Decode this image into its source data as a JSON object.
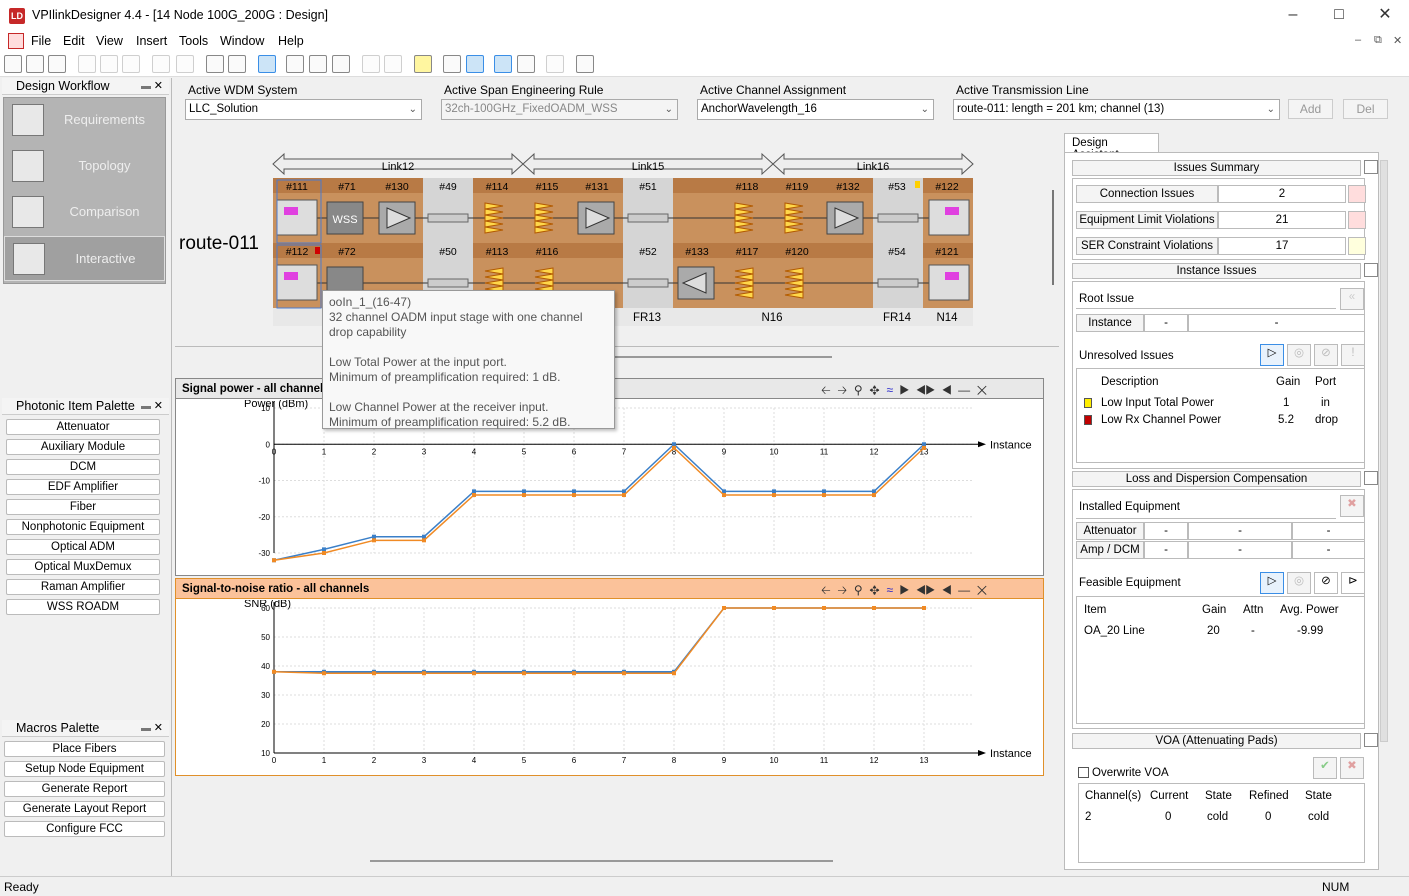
{
  "window": {
    "title": "VPIlinkDesigner 4.4 - [14 Node 100G_200G : Design]",
    "logo": "LD"
  },
  "menu": [
    "File",
    "Edit",
    "View",
    "Insert",
    "Tools",
    "Window",
    "Help"
  ],
  "left": {
    "workflow_title": "Design Workflow",
    "workflow": [
      "Requirements",
      "Topology",
      "Comparison",
      "Interactive"
    ],
    "palette_title": "Photonic Item Palette",
    "palette": [
      "Attenuator",
      "Auxiliary Module",
      "DCM",
      "EDF Amplifier",
      "Fiber",
      "Nonphotonic Equipment",
      "Optical ADM",
      "Optical MuxDemux",
      "Raman Amplifier",
      "WSS ROADM"
    ],
    "macros_title": "Macros Palette",
    "macros": [
      "Place Fibers",
      "Setup Node Equipment",
      "Generate Report",
      "Generate Layout Report",
      "Configure FCC"
    ]
  },
  "selectors": {
    "wdm": {
      "label": "Active WDM System",
      "value": "LLC_Solution"
    },
    "span": {
      "label": "Active Span Engineering Rule",
      "value": "32ch-100GHz_FixedOADM_WSS"
    },
    "channel": {
      "label": "Active Channel Assignment",
      "value": "AnchorWavelength_16"
    },
    "line": {
      "label": "Active Transmission Line",
      "value": "route-011: length = 201 km; channel (13)"
    },
    "add": "Add",
    "del": "Del"
  },
  "topology": {
    "route": "route-011",
    "links": [
      "Link12",
      "Link15",
      "Link16"
    ],
    "top_ids": [
      "#111",
      "#71",
      "#130",
      "#49",
      "#114",
      "#115",
      "#131",
      "#51",
      "#118",
      "#119",
      "#132",
      "#53",
      "#122"
    ],
    "bottom_ids": [
      "#112",
      "#72",
      "#50",
      "#113",
      "#116",
      "#52",
      "#133",
      "#117",
      "#120",
      "#54",
      "#121"
    ],
    "node_labels": [
      "FR13",
      "N16",
      "FR14",
      "N14"
    ],
    "wss_label": "WSS"
  },
  "tooltip": {
    "title": "ooIn_1_(16-47)",
    "desc": "32 channel OADM input stage with one channel drop capability",
    "l1": "Low Total Power at the input port.",
    "l2": "Minimum of preamplification required: 1 dB.",
    "l3": "Low Channel Power at the receiver input.",
    "l4": "Minimum of preamplification required: 5.2 dB."
  },
  "power_chart": {
    "title": "Signal power - all channels",
    "ylabel": "Power (dBm)",
    "xlabel": "Instance"
  },
  "snr_chart": {
    "title": "Signal-to-noise ratio - all channels",
    "ylabel": "SNR (dB)",
    "xlabel": "Instance"
  },
  "chart_data": [
    {
      "type": "line",
      "title": "Signal power - all channels",
      "ylabel": "Power (dBm)",
      "xlabel": "Instance",
      "xlim": [
        0,
        14
      ],
      "ylim": [
        -30,
        10
      ],
      "yticks": [
        10,
        0,
        -10,
        -20,
        -30
      ],
      "x": [
        0,
        1,
        2,
        3,
        4,
        5,
        6,
        7,
        8,
        9,
        10,
        11,
        12,
        13
      ],
      "series": [
        {
          "values": [
            -32,
            -29,
            -25.5,
            -25.5,
            -13,
            -13,
            -13,
            -13,
            0,
            -13,
            -13,
            -13,
            -13,
            0
          ]
        },
        {
          "values": [
            -32,
            -30,
            -26.5,
            -26.5,
            -14,
            -14,
            -14,
            -14,
            -1,
            -14,
            -14,
            -14,
            -14,
            -1
          ]
        }
      ]
    },
    {
      "type": "line",
      "title": "Signal-to-noise ratio - all channels",
      "ylabel": "SNR (dB)",
      "xlabel": "Instance",
      "xlim": [
        0,
        14
      ],
      "ylim": [
        10,
        60
      ],
      "yticks": [
        60,
        50,
        40,
        30,
        20,
        10
      ],
      "x": [
        0,
        1,
        2,
        3,
        4,
        5,
        6,
        7,
        8,
        9,
        10,
        11,
        12,
        13
      ],
      "series": [
        {
          "values": [
            38,
            38,
            38,
            38,
            38,
            38,
            38,
            38,
            38,
            60,
            60,
            60,
            60,
            60
          ]
        },
        {
          "values": [
            38,
            37.5,
            37.5,
            37.5,
            37.5,
            37.5,
            37.5,
            37.5,
            37.5,
            60,
            60,
            60,
            60,
            60
          ]
        }
      ]
    }
  ],
  "assistant": {
    "tab": "Design Assistant",
    "issues_summary": "Issues Summary",
    "summary": [
      {
        "label": "Connection Issues",
        "value": "2"
      },
      {
        "label": "Equipment Limit Violations",
        "value": "21"
      },
      {
        "label": "SER Constraint Violations",
        "value": "17"
      }
    ],
    "instance_issues": "Instance Issues",
    "root_issue": "Root Issue",
    "instance": "Instance",
    "dash": "-",
    "unresolved": "Unresolved Issues",
    "issue_cols": [
      "Description",
      "Gain",
      "Port"
    ],
    "issues": [
      {
        "desc": "Low Input Total Power",
        "gain": "1",
        "port": "in",
        "color": "#ffee00"
      },
      {
        "desc": "Low Rx Channel Power",
        "gain": "5.2",
        "port": "drop",
        "color": "#c00000"
      }
    ],
    "loss_title": "Loss and Dispersion Compensation",
    "installed": "Installed Equipment",
    "attenuator": "Attenuator",
    "ampdcm": "Amp / DCM",
    "feasible": "Feasible Equipment",
    "feas_cols": [
      "Item",
      "Gain",
      "Attn",
      "Avg. Power"
    ],
    "feas_row": {
      "item": "OA_20 Line",
      "gain": "20",
      "attn": "-",
      "power": "-9.99"
    },
    "voa_title": "VOA (Attenuating Pads)",
    "overwrite": "Overwrite VOA",
    "voa_cols": [
      "Channel(s)",
      "Current",
      "State",
      "Refined",
      "State"
    ],
    "voa_row": [
      "2",
      "0",
      "cold",
      "0",
      "cold"
    ]
  },
  "status": {
    "left": "Ready",
    "right": "NUM"
  }
}
